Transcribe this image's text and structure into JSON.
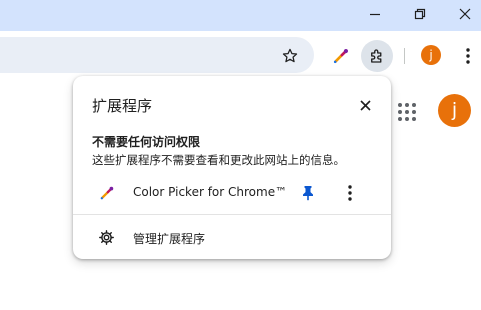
{
  "window": {
    "controls": [
      {
        "name": "minimize",
        "icon": "minimize-icon"
      },
      {
        "name": "restore",
        "icon": "restore-icon"
      },
      {
        "name": "close",
        "icon": "close-icon"
      }
    ]
  },
  "toolbar": {
    "bookmark_icon": "star-icon",
    "color_picker_icon": "color-picker-icon",
    "extensions_icon": "puzzle-icon",
    "profile_initial": "j",
    "menu_icon": "kebab-menu-icon"
  },
  "page": {
    "apps_icon": "apps-grid-icon",
    "profile_initial": "j"
  },
  "popup": {
    "title": "扩展程序",
    "access_heading": "不需要任何访问权限",
    "access_description": "这些扩展程序不需要查看和更改此网站上的信息。",
    "extensions": [
      {
        "name": "Color Picker for Chrome™",
        "icon": "color-picker-icon",
        "pinned": true
      }
    ],
    "manage_label": "管理扩展程序"
  },
  "colors": {
    "titlebar": "#d3e3fd",
    "omnibox": "#e9eef6",
    "avatar": "#e8710a",
    "pin": "#0b57d0"
  }
}
